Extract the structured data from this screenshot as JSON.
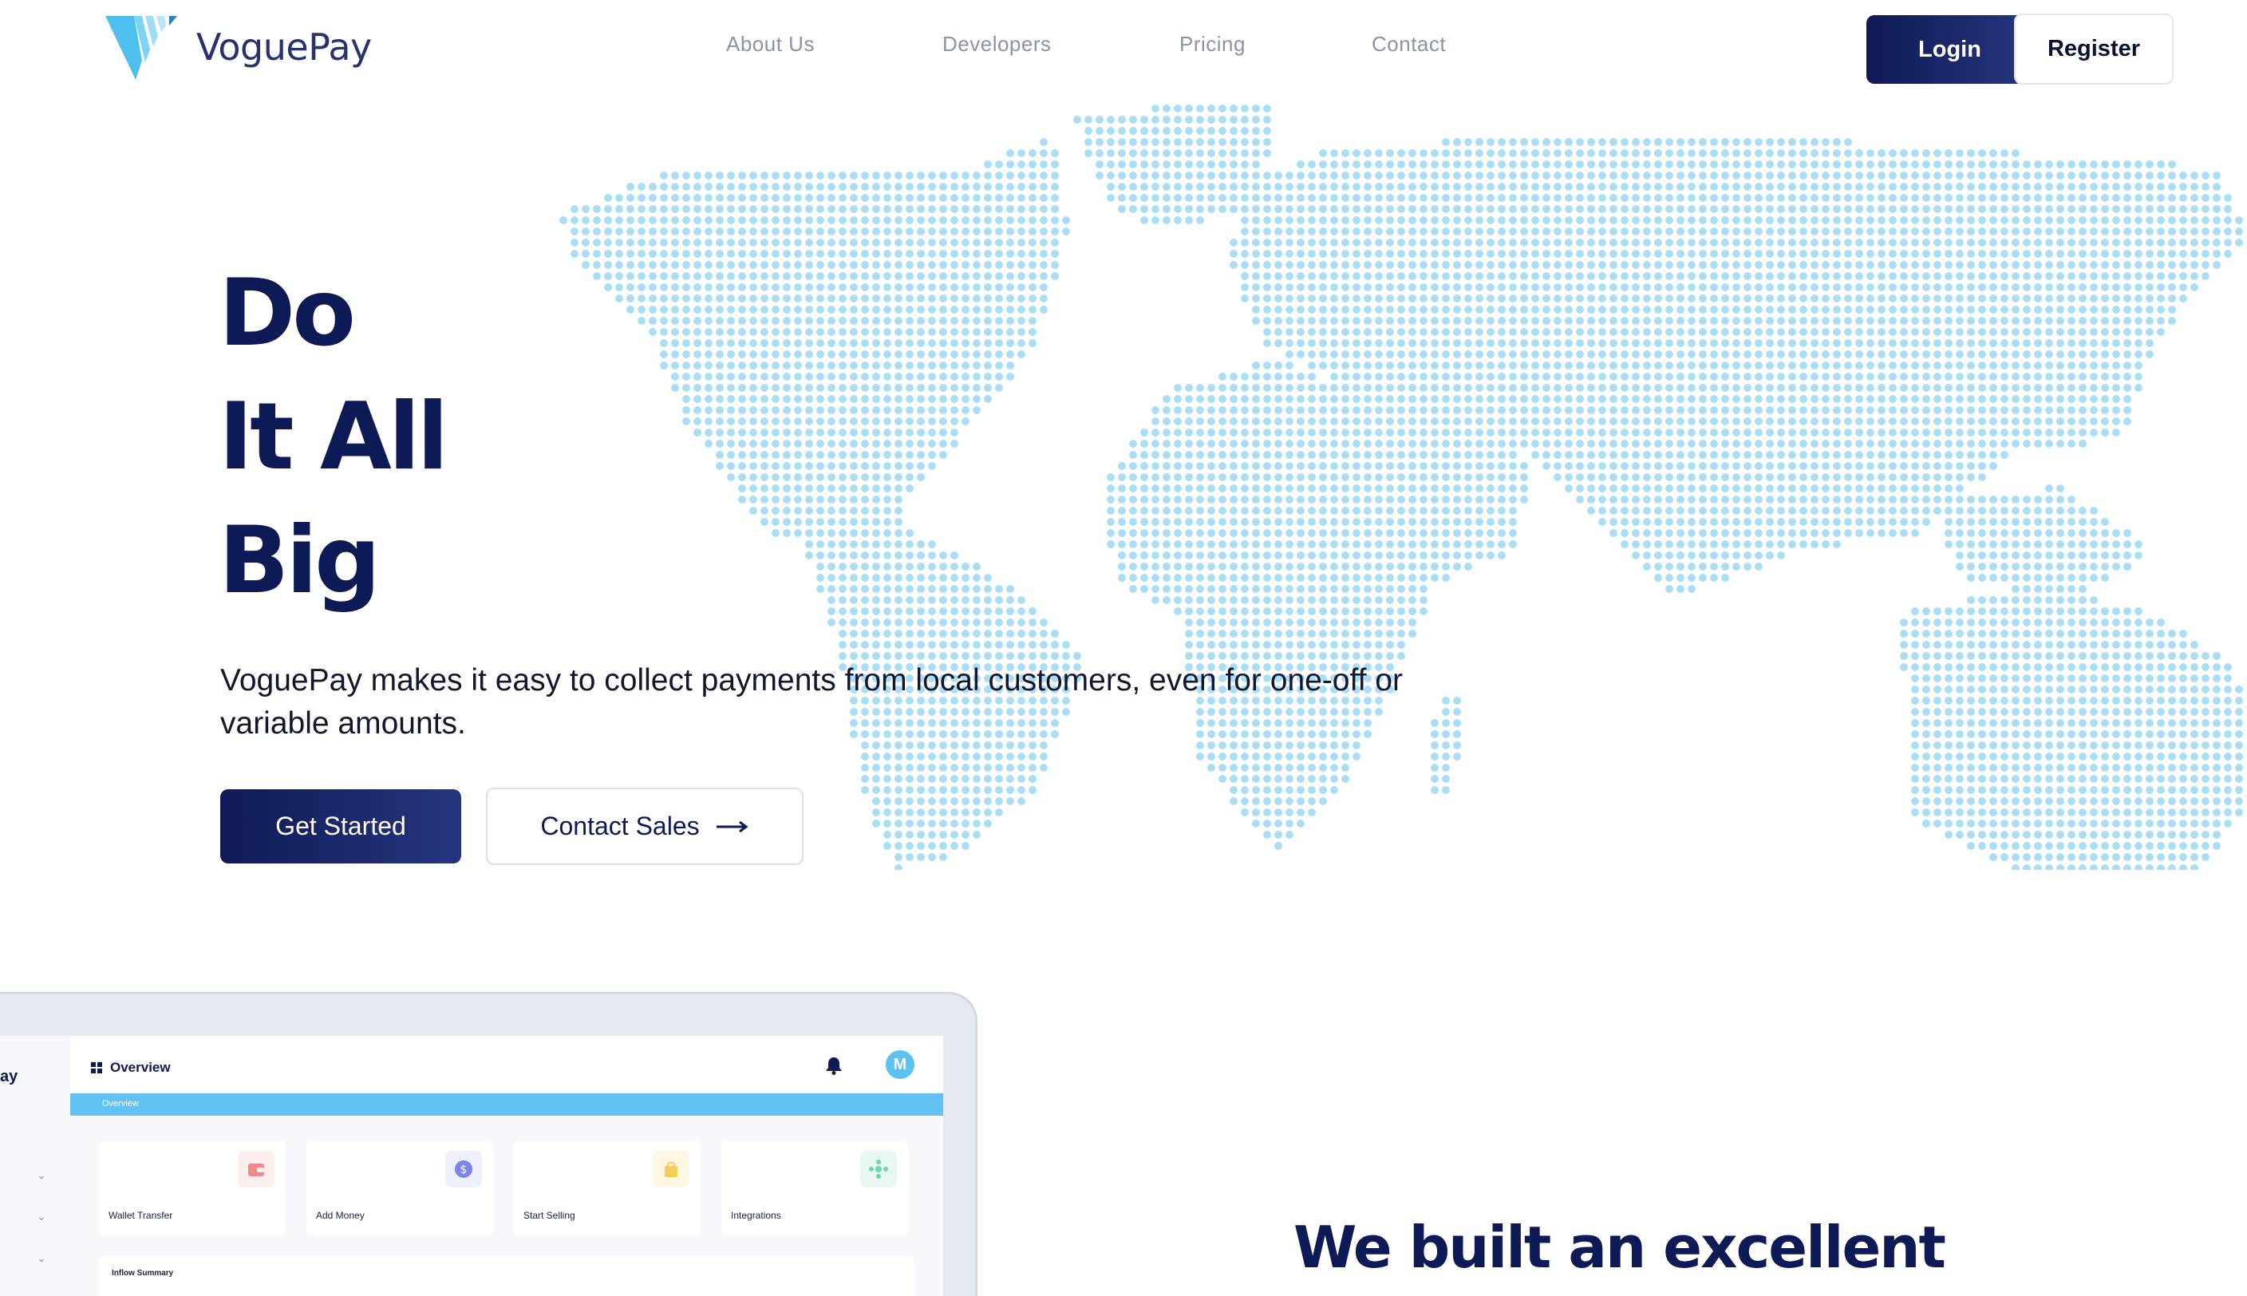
{
  "brand": {
    "name": "VoguePay",
    "logo_icon": "voguepay-chevron-logo",
    "primary_color": "#0e1a55",
    "accent_color": "#5cc2ef"
  },
  "nav": {
    "items": [
      "About Us",
      "Developers",
      "Pricing",
      "Contact"
    ]
  },
  "auth": {
    "login_label": "Login",
    "register_label": "Register"
  },
  "hero": {
    "title_lines": [
      "Do",
      "It All",
      "Big"
    ],
    "description": "VoguePay makes it easy to collect payments from local customers, even for one-off or variable amounts.",
    "primary_cta": "Get Started",
    "secondary_cta": "Contact Sales",
    "secondary_cta_icon": "arrow-right-icon",
    "background": "dotted-world-map",
    "map_dot_color": "#a9def6"
  },
  "dashboard": {
    "sidebar_logo_fragment": "ay",
    "header_title": "Overview",
    "breadcrumb": "Overview",
    "avatar_initial": "M",
    "icons": [
      "grid-icon",
      "bell-icon",
      "chevron-down-icon"
    ],
    "cards": [
      {
        "label": "Wallet Transfer",
        "icon": "wallet-icon",
        "icon_color": "#f08a8a",
        "icon_bg": "#fdeeee"
      },
      {
        "label": "Add Money",
        "icon": "dollar-icon",
        "icon_color": "#7c86e8",
        "icon_bg": "#eef0fd"
      },
      {
        "label": "Start Selling",
        "icon": "shopping-bag-icon",
        "icon_color": "#f5cf55",
        "icon_bg": "#fdf7e3"
      },
      {
        "label": "Integrations",
        "icon": "integrations-icon",
        "icon_color": "#6bd9a6",
        "icon_bg": "#e8f8f0"
      }
    ],
    "inflow_title": "Inflow Summary"
  },
  "section": {
    "heading": "We built an excellent"
  }
}
